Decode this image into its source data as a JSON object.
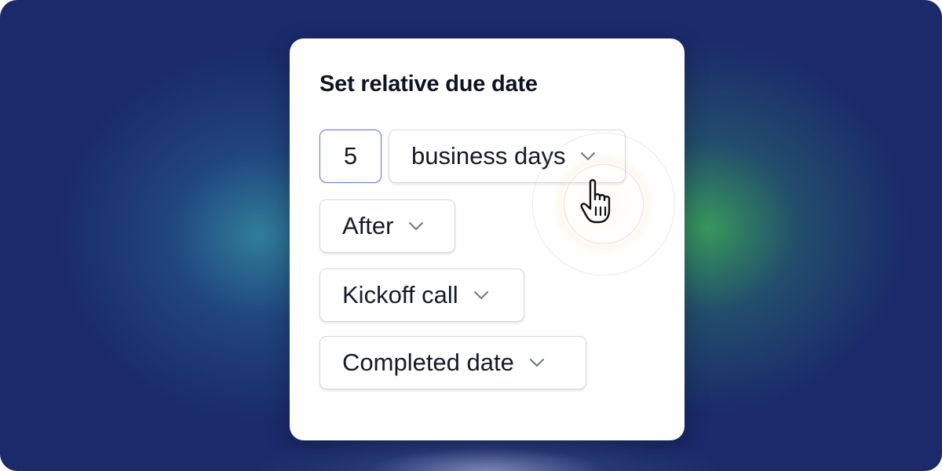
{
  "dialog": {
    "title": "Set relative due date"
  },
  "form": {
    "amount_value": "5",
    "unit_select": {
      "selected": "business days"
    },
    "relation_select": {
      "selected": "After"
    },
    "event_select": {
      "selected": "Kickoff call"
    },
    "date_type_select": {
      "selected": "Completed date"
    }
  },
  "icons": {
    "chevron": "chevron-down-icon",
    "cursor": "hand-pointer-cursor-icon"
  },
  "colors": {
    "background": "#1a2a6b",
    "card": "#ffffff",
    "text": "#16192a",
    "focus_border": "#6b7de0",
    "chevron": "#707585"
  }
}
